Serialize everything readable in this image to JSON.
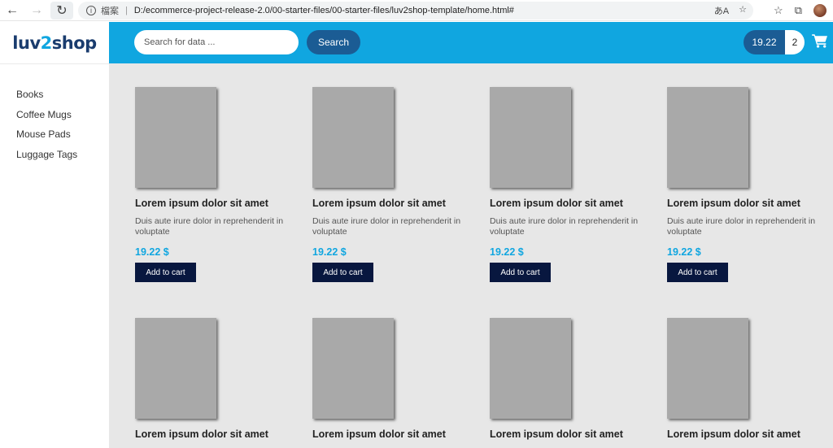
{
  "browser": {
    "back_icon": "←",
    "forward_icon": "→",
    "refresh_icon": "↻",
    "scheme_label": "檔案",
    "separator": "|",
    "url": "D:/ecommerce-project-release-2.0/00-starter-files/00-starter-files/luv2shop-template/home.html#",
    "read_aloud_icon": "あA",
    "favorite_icon": "☆",
    "favorites_icon": "☆",
    "collections_icon": "⧉"
  },
  "header": {
    "logo": {
      "part1": "luv",
      "part2": "2",
      "part3": "shop"
    },
    "search_placeholder": "Search for data ...",
    "search_button": "Search",
    "cart_total": "19.22",
    "cart_quantity": "2",
    "accent_color": "#10a6e0"
  },
  "sidebar": {
    "items": [
      {
        "label": "Books"
      },
      {
        "label": "Coffee Mugs"
      },
      {
        "label": "Mouse Pads"
      },
      {
        "label": "Luggage Tags"
      }
    ]
  },
  "products": [
    {
      "title": "Lorem ipsum dolor sit amet",
      "desc": "Duis aute irure dolor in reprehenderit in voluptate",
      "price": "19.22 $",
      "button": "Add to cart"
    },
    {
      "title": "Lorem ipsum dolor sit amet",
      "desc": "Duis aute irure dolor in reprehenderit in voluptate",
      "price": "19.22 $",
      "button": "Add to cart"
    },
    {
      "title": "Lorem ipsum dolor sit amet",
      "desc": "Duis aute irure dolor in reprehenderit in voluptate",
      "price": "19.22 $",
      "button": "Add to cart"
    },
    {
      "title": "Lorem ipsum dolor sit amet",
      "desc": "Duis aute irure dolor in reprehenderit in voluptate",
      "price": "19.22 $",
      "button": "Add to cart"
    },
    {
      "title": "Lorem ipsum dolor sit amet"
    },
    {
      "title": "Lorem ipsum dolor sit amet"
    },
    {
      "title": "Lorem ipsum dolor sit amet"
    },
    {
      "title": "Lorem ipsum dolor sit amet"
    }
  ]
}
